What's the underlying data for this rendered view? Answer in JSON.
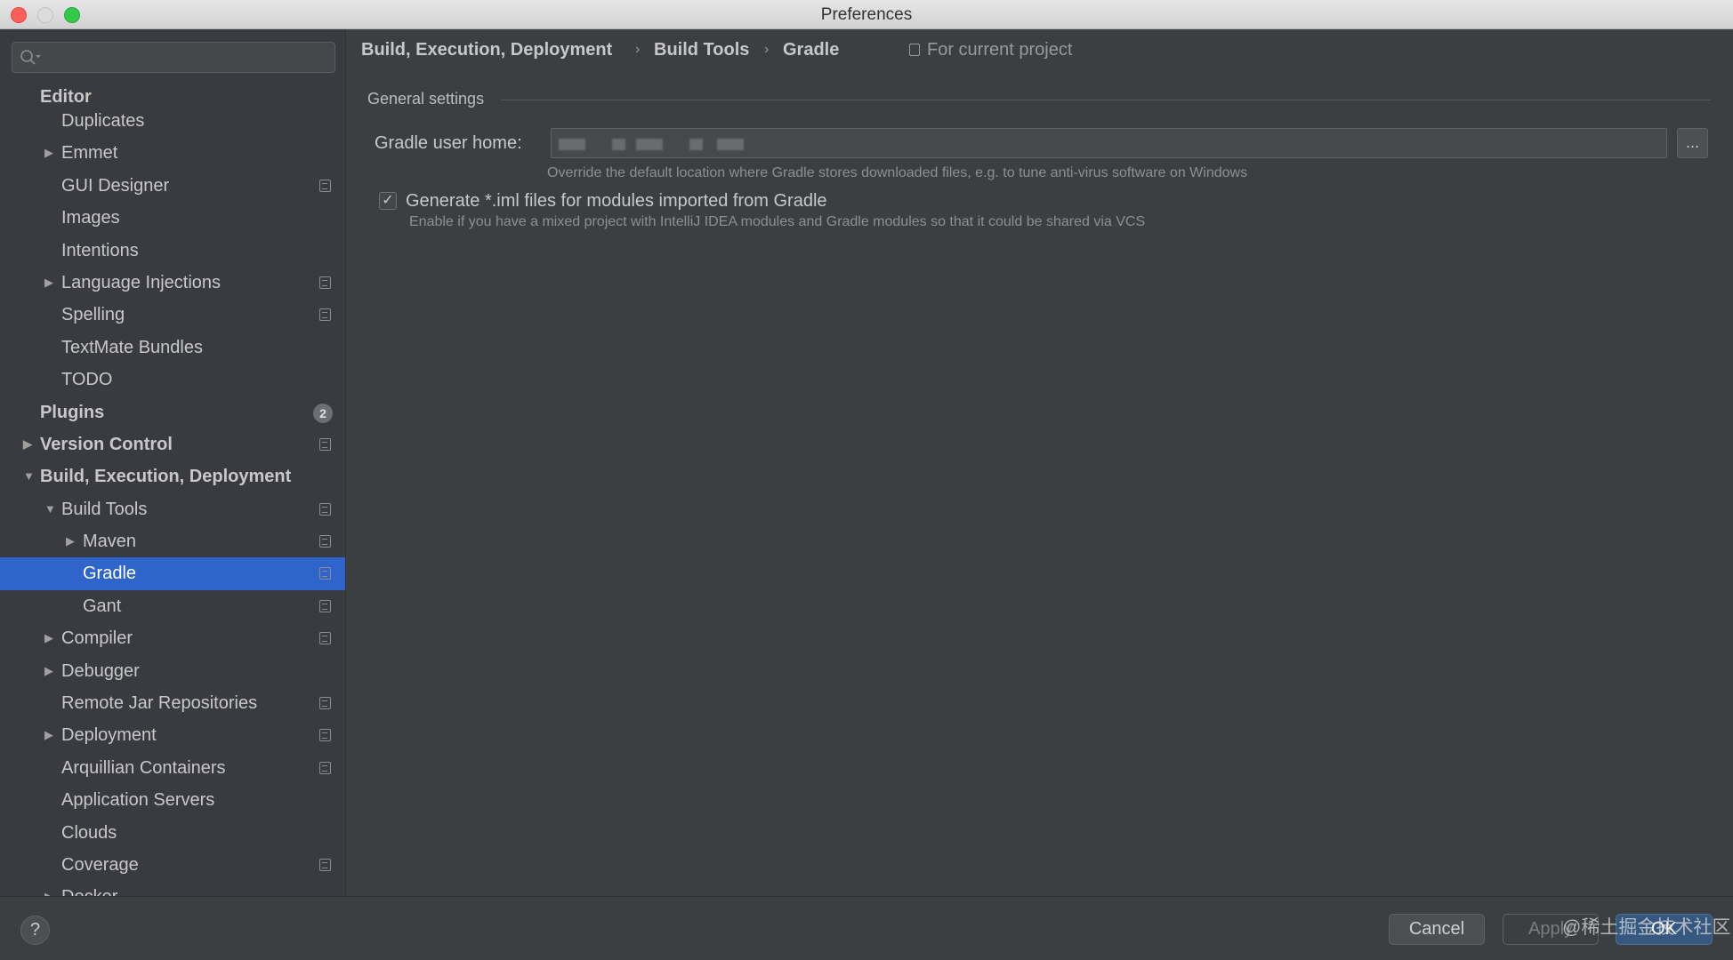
{
  "window": {
    "title": "Preferences"
  },
  "search": {
    "placeholder": ""
  },
  "sidebar": {
    "items": [
      {
        "label": "Editor",
        "level": 0,
        "bold": true,
        "header": true
      },
      {
        "label": "Duplicates",
        "level": 1
      },
      {
        "label": "Emmet",
        "level": 1,
        "arrow": "collapsed"
      },
      {
        "label": "GUI Designer",
        "level": 1,
        "project": true
      },
      {
        "label": "Images",
        "level": 1
      },
      {
        "label": "Intentions",
        "level": 1
      },
      {
        "label": "Language Injections",
        "level": 1,
        "arrow": "collapsed",
        "project": true
      },
      {
        "label": "Spelling",
        "level": 1,
        "project": true
      },
      {
        "label": "TextMate Bundles",
        "level": 1
      },
      {
        "label": "TODO",
        "level": 1
      },
      {
        "label": "Plugins",
        "level": 0,
        "bold": true,
        "badge": "2"
      },
      {
        "label": "Version Control",
        "level": 0,
        "bold": true,
        "arrow": "collapsed",
        "project": true
      },
      {
        "label": "Build, Execution, Deployment",
        "level": 0,
        "bold": true,
        "arrow": "expanded"
      },
      {
        "label": "Build Tools",
        "level": 1,
        "arrow": "expanded",
        "project": true
      },
      {
        "label": "Maven",
        "level": 2,
        "arrow": "collapsed",
        "project": true
      },
      {
        "label": "Gradle",
        "level": 2,
        "selected": true,
        "project": true
      },
      {
        "label": "Gant",
        "level": 2,
        "project": true
      },
      {
        "label": "Compiler",
        "level": 1,
        "arrow": "collapsed",
        "project": true
      },
      {
        "label": "Debugger",
        "level": 1,
        "arrow": "collapsed"
      },
      {
        "label": "Remote Jar Repositories",
        "level": 1,
        "project": true
      },
      {
        "label": "Deployment",
        "level": 1,
        "arrow": "collapsed",
        "project": true
      },
      {
        "label": "Arquillian Containers",
        "level": 1,
        "project": true
      },
      {
        "label": "Application Servers",
        "level": 1
      },
      {
        "label": "Clouds",
        "level": 1
      },
      {
        "label": "Coverage",
        "level": 1,
        "project": true
      },
      {
        "label": "Docker",
        "level": 1,
        "arrow": "collapsed"
      }
    ]
  },
  "breadcrumb": [
    "Build, Execution, Deployment",
    "Build Tools",
    "Gradle"
  ],
  "scope_label": "For current project",
  "general": {
    "section_title": "General settings",
    "gradle_home_label": "Gradle user home:",
    "browse_label": "...",
    "gradle_home_hint": "Override the default location where Gradle stores downloaded files, e.g. to tune anti-virus software on Windows",
    "iml_label": "Generate *.iml files for modules imported from Gradle",
    "iml_checked": true,
    "iml_hint": "Enable if you have a mixed project with IntelliJ IDEA modules and Gradle modules so that it could be shared via VCS"
  },
  "footer": {
    "help": "?",
    "cancel": "Cancel",
    "apply": "Apply",
    "ok": "OK"
  },
  "watermark": "@稀土掘金技术社区",
  "colors": {
    "selection": "#2f65ca",
    "ok_button": "#365880"
  }
}
